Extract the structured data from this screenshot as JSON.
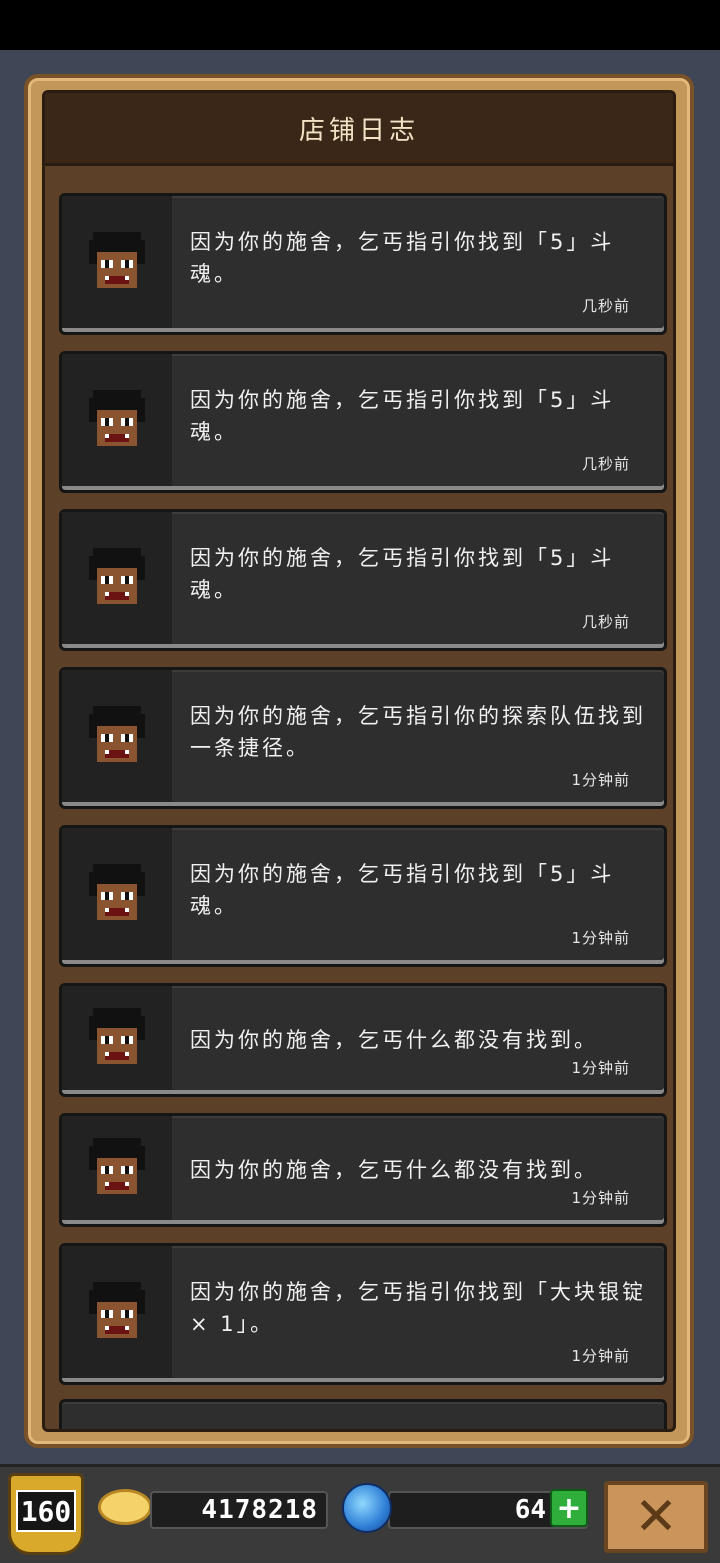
{
  "header": {
    "title": "店铺日志"
  },
  "logs": [
    {
      "text": "因为你的施舍，乞丐指引你找到「5」斗魂。",
      "time": "几秒前"
    },
    {
      "text": "因为你的施舍，乞丐指引你找到「5」斗魂。",
      "time": "几秒前"
    },
    {
      "text": "因为你的施舍，乞丐指引你找到「5」斗魂。",
      "time": "几秒前"
    },
    {
      "text": "因为你的施舍，乞丐指引你的探索队伍找到一条捷径。",
      "time": "1分钟前"
    },
    {
      "text": "因为你的施舍，乞丐指引你找到「5」斗魂。",
      "time": "1分钟前"
    },
    {
      "text": "因为你的施舍，乞丐什么都没有找到。",
      "time": "1分钟前"
    },
    {
      "text": "因为你的施舍，乞丐什么都没有找到。",
      "time": "1分钟前"
    },
    {
      "text": "因为你的施舍，乞丐指引你找到「大块银锭 × 1」。",
      "time": "1分钟前"
    }
  ],
  "footer": {
    "level": "160",
    "gold": "4178218",
    "gems": "64",
    "plus_label": "+",
    "close_label": "✕"
  },
  "icons": {
    "portrait": "beggar-portrait-icon",
    "coin": "gold-coin-icon",
    "gem": "blue-gem-icon"
  }
}
